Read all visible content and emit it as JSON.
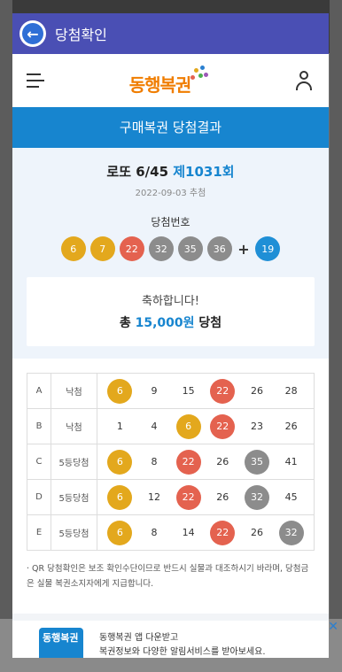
{
  "window": {
    "title": "당첨확인"
  },
  "header": {
    "logo_text": "동행복권"
  },
  "banner": {
    "label": "구매복권 당첨결과"
  },
  "draw": {
    "game": "로또 6/45",
    "round": "제1031회",
    "date": "2022-09-03 추첨",
    "win_label": "당첨번호"
  },
  "winning_numbers": [
    {
      "value": "6",
      "color": "#e3a81d"
    },
    {
      "value": "7",
      "color": "#e3a81d"
    },
    {
      "value": "22",
      "color": "#e4624f"
    },
    {
      "value": "32",
      "color": "#8c8c8c"
    },
    {
      "value": "35",
      "color": "#8c8c8c"
    },
    {
      "value": "36",
      "color": "#8c8c8c"
    }
  ],
  "bonus": {
    "plus": "+",
    "value": "19",
    "color": "#1f8fd6"
  },
  "congrats": {
    "line1": "축하합니다!",
    "prefix": "총",
    "amount": "15,000원",
    "suffix": "당첨"
  },
  "tickets": [
    {
      "label": "A",
      "result": "낙첨",
      "numbers": [
        {
          "v": "6",
          "c": "yellow"
        },
        {
          "v": "9",
          "c": ""
        },
        {
          "v": "15",
          "c": ""
        },
        {
          "v": "22",
          "c": "red"
        },
        {
          "v": "26",
          "c": ""
        },
        {
          "v": "28",
          "c": ""
        }
      ]
    },
    {
      "label": "B",
      "result": "낙첨",
      "numbers": [
        {
          "v": "1",
          "c": ""
        },
        {
          "v": "4",
          "c": ""
        },
        {
          "v": "6",
          "c": "yellow"
        },
        {
          "v": "22",
          "c": "red"
        },
        {
          "v": "23",
          "c": ""
        },
        {
          "v": "26",
          "c": ""
        }
      ]
    },
    {
      "label": "C",
      "result": "5등당첨",
      "numbers": [
        {
          "v": "6",
          "c": "yellow"
        },
        {
          "v": "8",
          "c": ""
        },
        {
          "v": "22",
          "c": "red"
        },
        {
          "v": "26",
          "c": ""
        },
        {
          "v": "35",
          "c": "gray"
        },
        {
          "v": "41",
          "c": ""
        }
      ]
    },
    {
      "label": "D",
      "result": "5등당첨",
      "numbers": [
        {
          "v": "6",
          "c": "yellow"
        },
        {
          "v": "12",
          "c": ""
        },
        {
          "v": "22",
          "c": "red"
        },
        {
          "v": "26",
          "c": ""
        },
        {
          "v": "32",
          "c": "gray"
        },
        {
          "v": "45",
          "c": ""
        }
      ]
    },
    {
      "label": "E",
      "result": "5등당첨",
      "numbers": [
        {
          "v": "6",
          "c": "yellow"
        },
        {
          "v": "8",
          "c": ""
        },
        {
          "v": "14",
          "c": ""
        },
        {
          "v": "22",
          "c": "red"
        },
        {
          "v": "26",
          "c": ""
        },
        {
          "v": "32",
          "c": "gray"
        }
      ]
    }
  ],
  "note": "· QR 당첨확인은 보조 확인수단이므로 반드시 실물과 대조하시기 바라며, 당첨금은 실물 복권소지자에게 지급합니다.",
  "footer": {
    "app_icon_text": "동행복권",
    "line1": "동행복권 앱 다운받고",
    "line2": "복권정보와 다양한 알림서비스를 받아보세요."
  },
  "ad": {
    "close": "✕"
  }
}
